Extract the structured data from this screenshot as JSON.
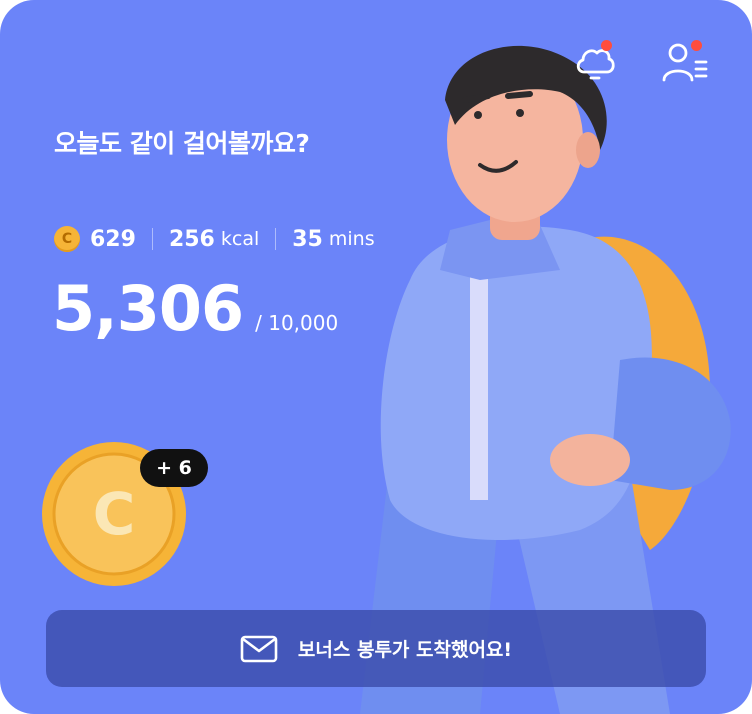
{
  "header": {
    "icons": [
      "weather-cloud-icon",
      "profile-menu-icon"
    ],
    "notification_color": "#ff4d3d"
  },
  "greeting": "오늘도 같이 걸어볼까요?",
  "stats": {
    "coins": "629",
    "kcal_value": "256",
    "kcal_unit": "kcal",
    "mins_value": "35",
    "mins_unit": "mins",
    "coin_glyph": "C"
  },
  "steps": {
    "current": "5,306",
    "goal": "/ 10,000"
  },
  "reward": {
    "badge": "+ 6",
    "coin_glyph": "C"
  },
  "banner": {
    "text": "보너스 봉투가 도착했어요!",
    "icon": "envelope-icon"
  },
  "colors": {
    "background": "#6b84f9",
    "coin": "#f6b437",
    "banner": "#3a4aa8"
  }
}
